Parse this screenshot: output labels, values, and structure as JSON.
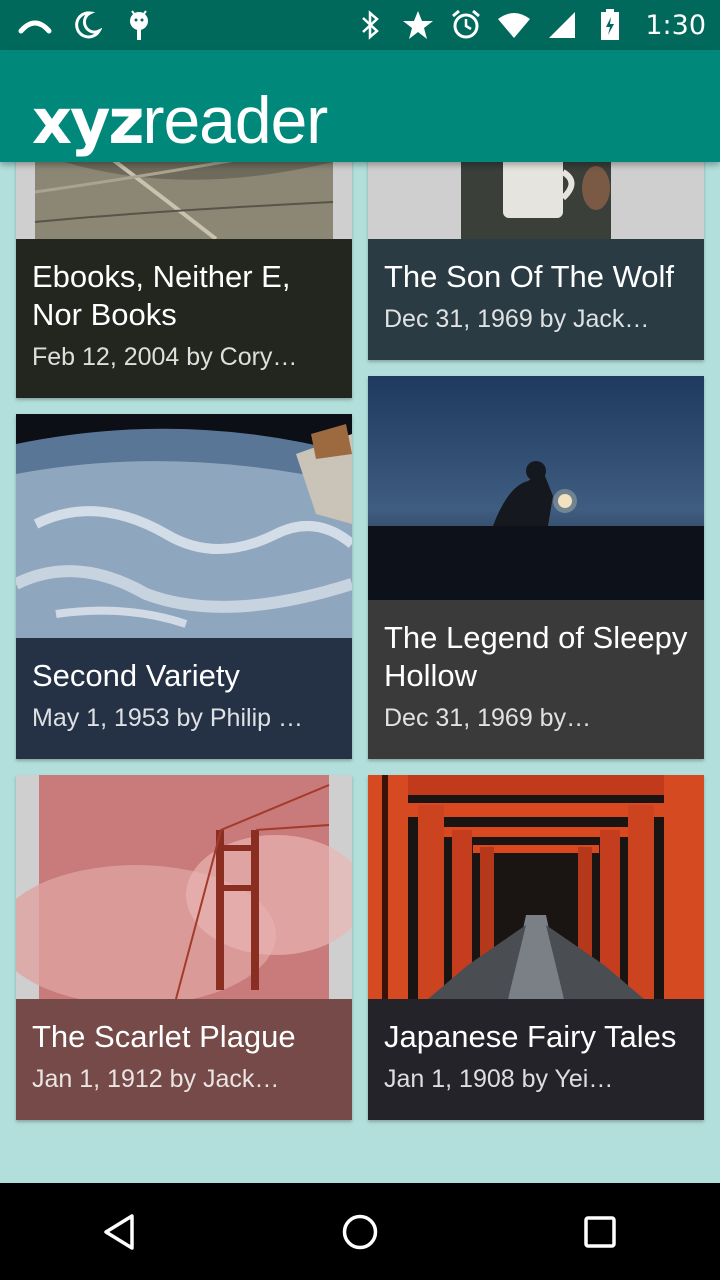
{
  "status_bar": {
    "time": "1:30",
    "left_icons": [
      "rainbow-icon",
      "moon-icon",
      "android-debug-icon"
    ],
    "right_icons": [
      "bluetooth-icon",
      "star-icon",
      "alarm-icon",
      "wifi-icon",
      "signal-icon",
      "battery-charging-icon"
    ]
  },
  "app_bar": {
    "logo_bold": "xyz",
    "logo_light": "reader",
    "background": "#00897b"
  },
  "articles": [
    {
      "title": "Ebooks, Neither E, Nor Books",
      "subtitle": "Feb 12, 2004 by Cory…",
      "footer_color": "#22261f",
      "image": "net-texture"
    },
    {
      "title": "The Son Of The Wolf",
      "subtitle": "Dec 31, 1969 by Jack…",
      "footer_color": "#2a3b43",
      "image": "adventure-mug"
    },
    {
      "title": "Second Variety",
      "subtitle": "May 1, 1953 by Philip …",
      "footer_color": "#253246",
      "image": "earth-from-space"
    },
    {
      "title": "The Legend of Sleepy Hollow",
      "subtitle": "Dec 31, 1969 by…",
      "footer_color": "#3a3a3a",
      "image": "lantern-night"
    },
    {
      "title": "The Scarlet Plague",
      "subtitle": "Jan 1, 1912 by Jack…",
      "footer_color": "#764a48",
      "image": "bridge-red-fog"
    },
    {
      "title": "Japanese Fairy Tales",
      "subtitle": "Jan 1, 1908 by Yei…",
      "footer_color": "#24232a",
      "image": "torii-gates"
    }
  ],
  "nav_bar": {
    "buttons": [
      "back-icon",
      "home-icon",
      "recents-icon"
    ]
  }
}
